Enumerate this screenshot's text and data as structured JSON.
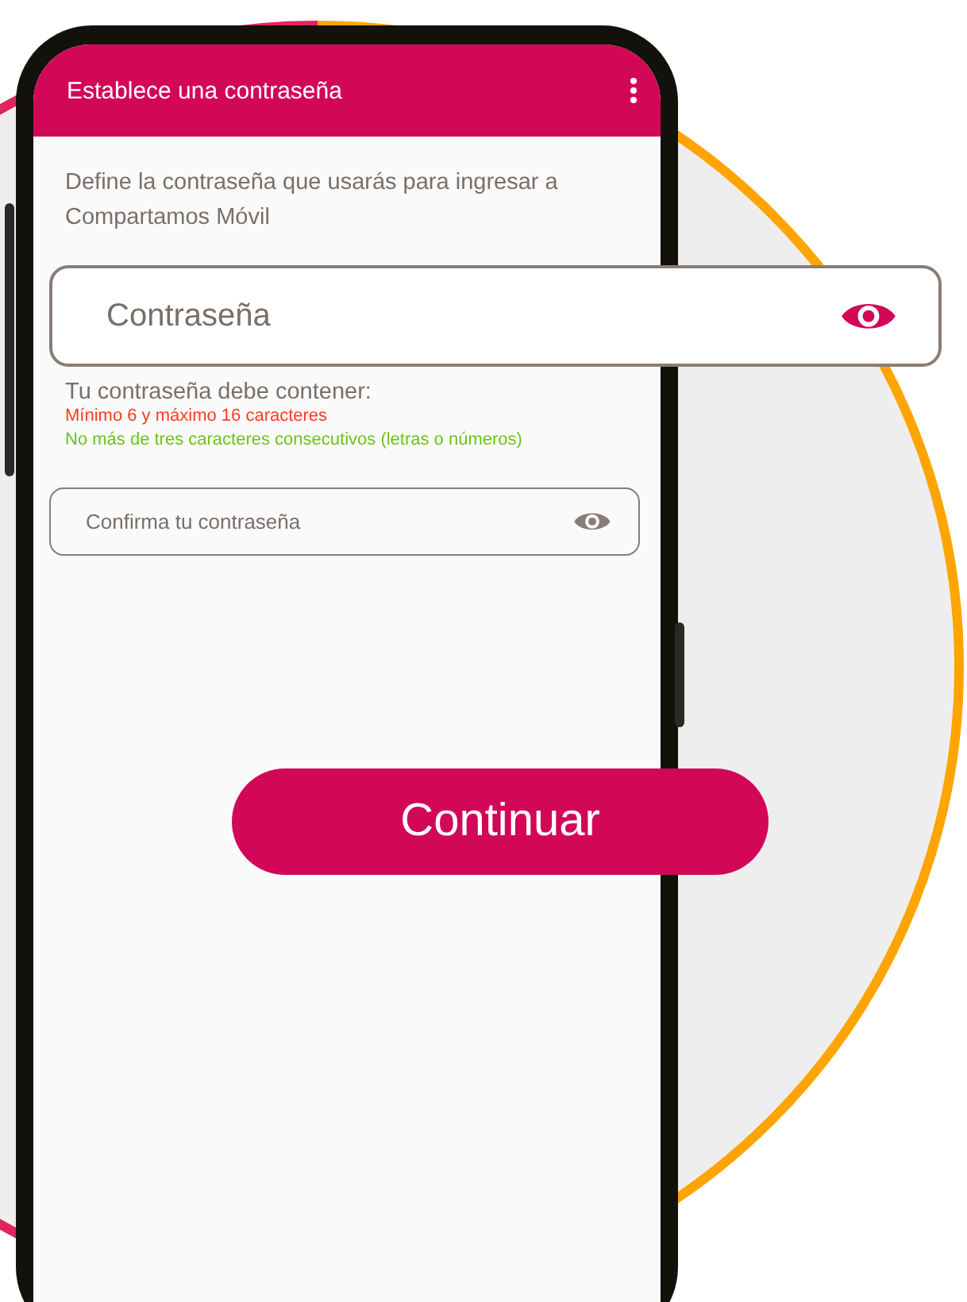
{
  "header": {
    "title": "Establece una contraseña"
  },
  "description": "Define la contraseña que usarás para ingresar a Compartamos Móvil",
  "password_field": {
    "placeholder": "Contraseña"
  },
  "requirements": {
    "title": "Tu contraseña debe contener:",
    "items": [
      {
        "text": "Mínimo 6 y máximo 16 caracteres",
        "met": false
      },
      {
        "text": "No más de tres caracteres consecutivos (letras o números)",
        "met": true
      }
    ]
  },
  "confirm_field": {
    "placeholder": "Confirma tu contraseña"
  },
  "continue_button": {
    "label": "Continuar"
  }
}
